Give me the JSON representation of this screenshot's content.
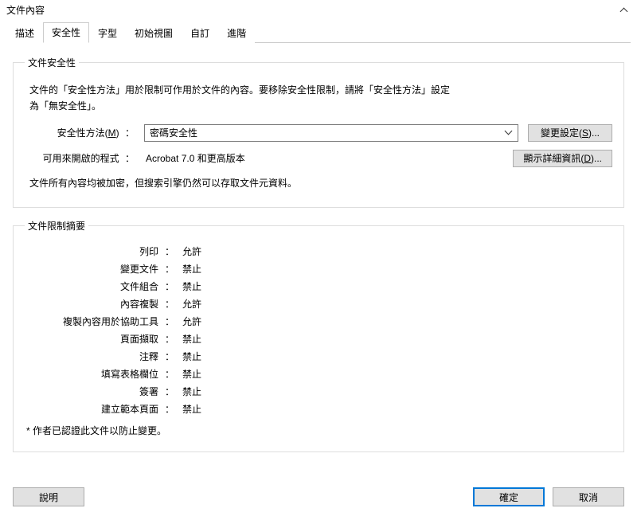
{
  "title": "文件內容",
  "tabs": {
    "describe": "描述",
    "security": "安全性",
    "fonts": "字型",
    "initial_view": "初始視圖",
    "custom": "自訂",
    "advanced": "進階"
  },
  "security_group": {
    "legend": "文件安全性",
    "description_line1": "文件的「安全性方法」用於限制可作用於文件的內容。要移除安全性限制，請將「安全性方法」設定",
    "description_line2": "為「無安全性」。",
    "method_label_prefix": "安全性方法(",
    "method_accel": "M",
    "method_label_suffix": ") ",
    "method_value": "密碼安全性",
    "change_btn_prefix": "變更設定(",
    "change_accel": "S",
    "change_btn_suffix": ")...",
    "open_with_label": "可用來開啟的程式 ",
    "open_with_value": "Acrobat 7.0 和更高版本",
    "details_btn_prefix": "顯示詳細資訊(",
    "details_accel": "D",
    "details_btn_suffix": ")...",
    "encrypted_note": "文件所有內容均被加密，但搜索引擎仍然可以存取文件元資料。"
  },
  "summary_group": {
    "legend": "文件限制摘要",
    "rows": [
      {
        "label": "列印",
        "value": "允許"
      },
      {
        "label": "變更文件",
        "value": "禁止"
      },
      {
        "label": "文件組合",
        "value": "禁止"
      },
      {
        "label": "內容複製",
        "value": "允許"
      },
      {
        "label": "複製內容用於協助工具",
        "value": "允許"
      },
      {
        "label": "頁面擷取",
        "value": "禁止"
      },
      {
        "label": "注釋",
        "value": "禁止"
      },
      {
        "label": "填寫表格欄位",
        "value": "禁止"
      },
      {
        "label": "簽署",
        "value": "禁止"
      },
      {
        "label": "建立範本頁面",
        "value": "禁止"
      }
    ],
    "footnote": "*   作者已認證此文件以防止變更。"
  },
  "buttons": {
    "help": "說明",
    "ok": "確定",
    "cancel": "取消"
  }
}
